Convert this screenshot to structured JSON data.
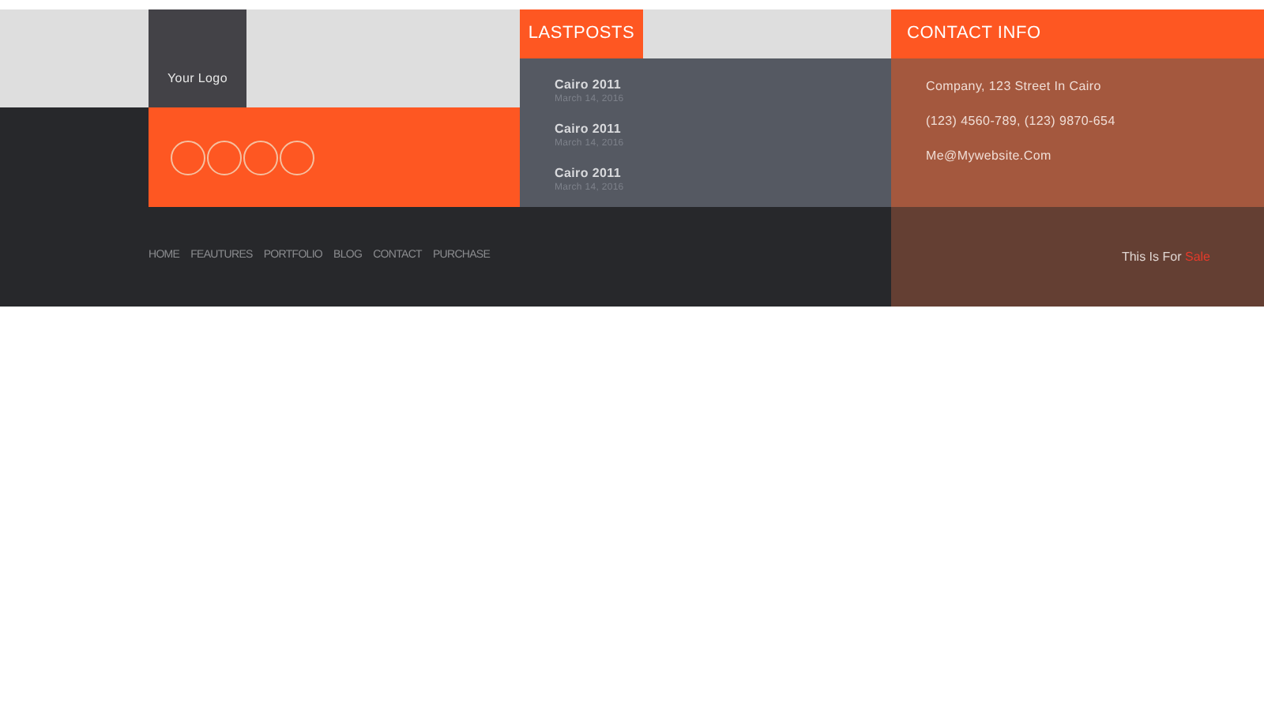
{
  "logo": {
    "text": "Your Logo"
  },
  "nav": [
    "HOME",
    "FEAUTURES",
    "PORTFOLIO",
    "BLOG",
    "CONTACT",
    "PURCHASE"
  ],
  "last_posts": {
    "title": "LASTPOSTS",
    "posts": [
      {
        "title": "Cairo 2011",
        "date": "March 14, 2016"
      },
      {
        "title": "Cairo 2011",
        "date": "March 14, 2016"
      },
      {
        "title": "Cairo 2011",
        "date": "March 14, 2016"
      }
    ]
  },
  "contact_info": {
    "title": "CONTACT INFO",
    "lines": [
      "Company, 123 Street In Cairo",
      "(123) 4560-789, (123) 9870-654",
      "Me@Mywebsite.Com"
    ]
  },
  "credit": {
    "text": "This Is For",
    "highlight": "Sale"
  }
}
